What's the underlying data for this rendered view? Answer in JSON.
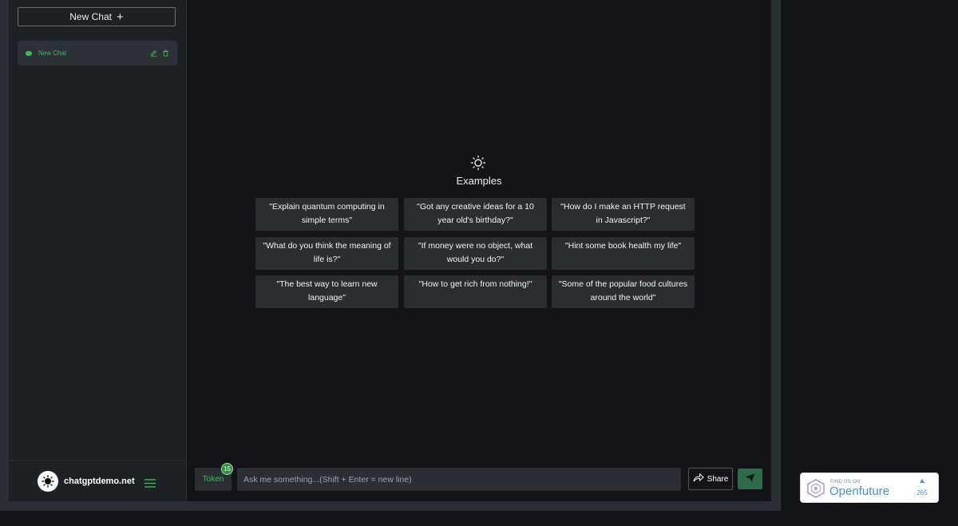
{
  "sidebar": {
    "new_chat_label": "New Chat",
    "new_chat_icon": "plus-icon",
    "chats": [
      {
        "label": "New Chat"
      }
    ],
    "footer": {
      "brand_name": "chatgptdemo.net"
    }
  },
  "main": {
    "examples_title": "Examples",
    "examples": [
      "\"Explain quantum computing in simple terms\"",
      "\"Got any creative ideas for a 10 year old's birthday?\"",
      "\"How do I make an HTTP request in Javascript?\"",
      "\"What do you think the meaning of life is?\"",
      "\"If money were no object, what would you do?\"",
      "\"Hint some book health my life\"",
      "\"The best way to learn new language\"",
      "\"How to get rich from nothing!\"",
      "\"Some of the popular food cultures around the world\""
    ]
  },
  "input": {
    "token_label": "Token",
    "token_count": "15",
    "placeholder": "Ask me something...(Shift + Enter = new line)",
    "share_label": "Share"
  },
  "openfuture": {
    "tagline": "FIND US ON",
    "name": "Openfuture",
    "count": "265"
  },
  "colors": {
    "accent_green": "#3fb950",
    "send_button": "#2f6b4a",
    "openfuture_blue": "#4a90c8"
  }
}
